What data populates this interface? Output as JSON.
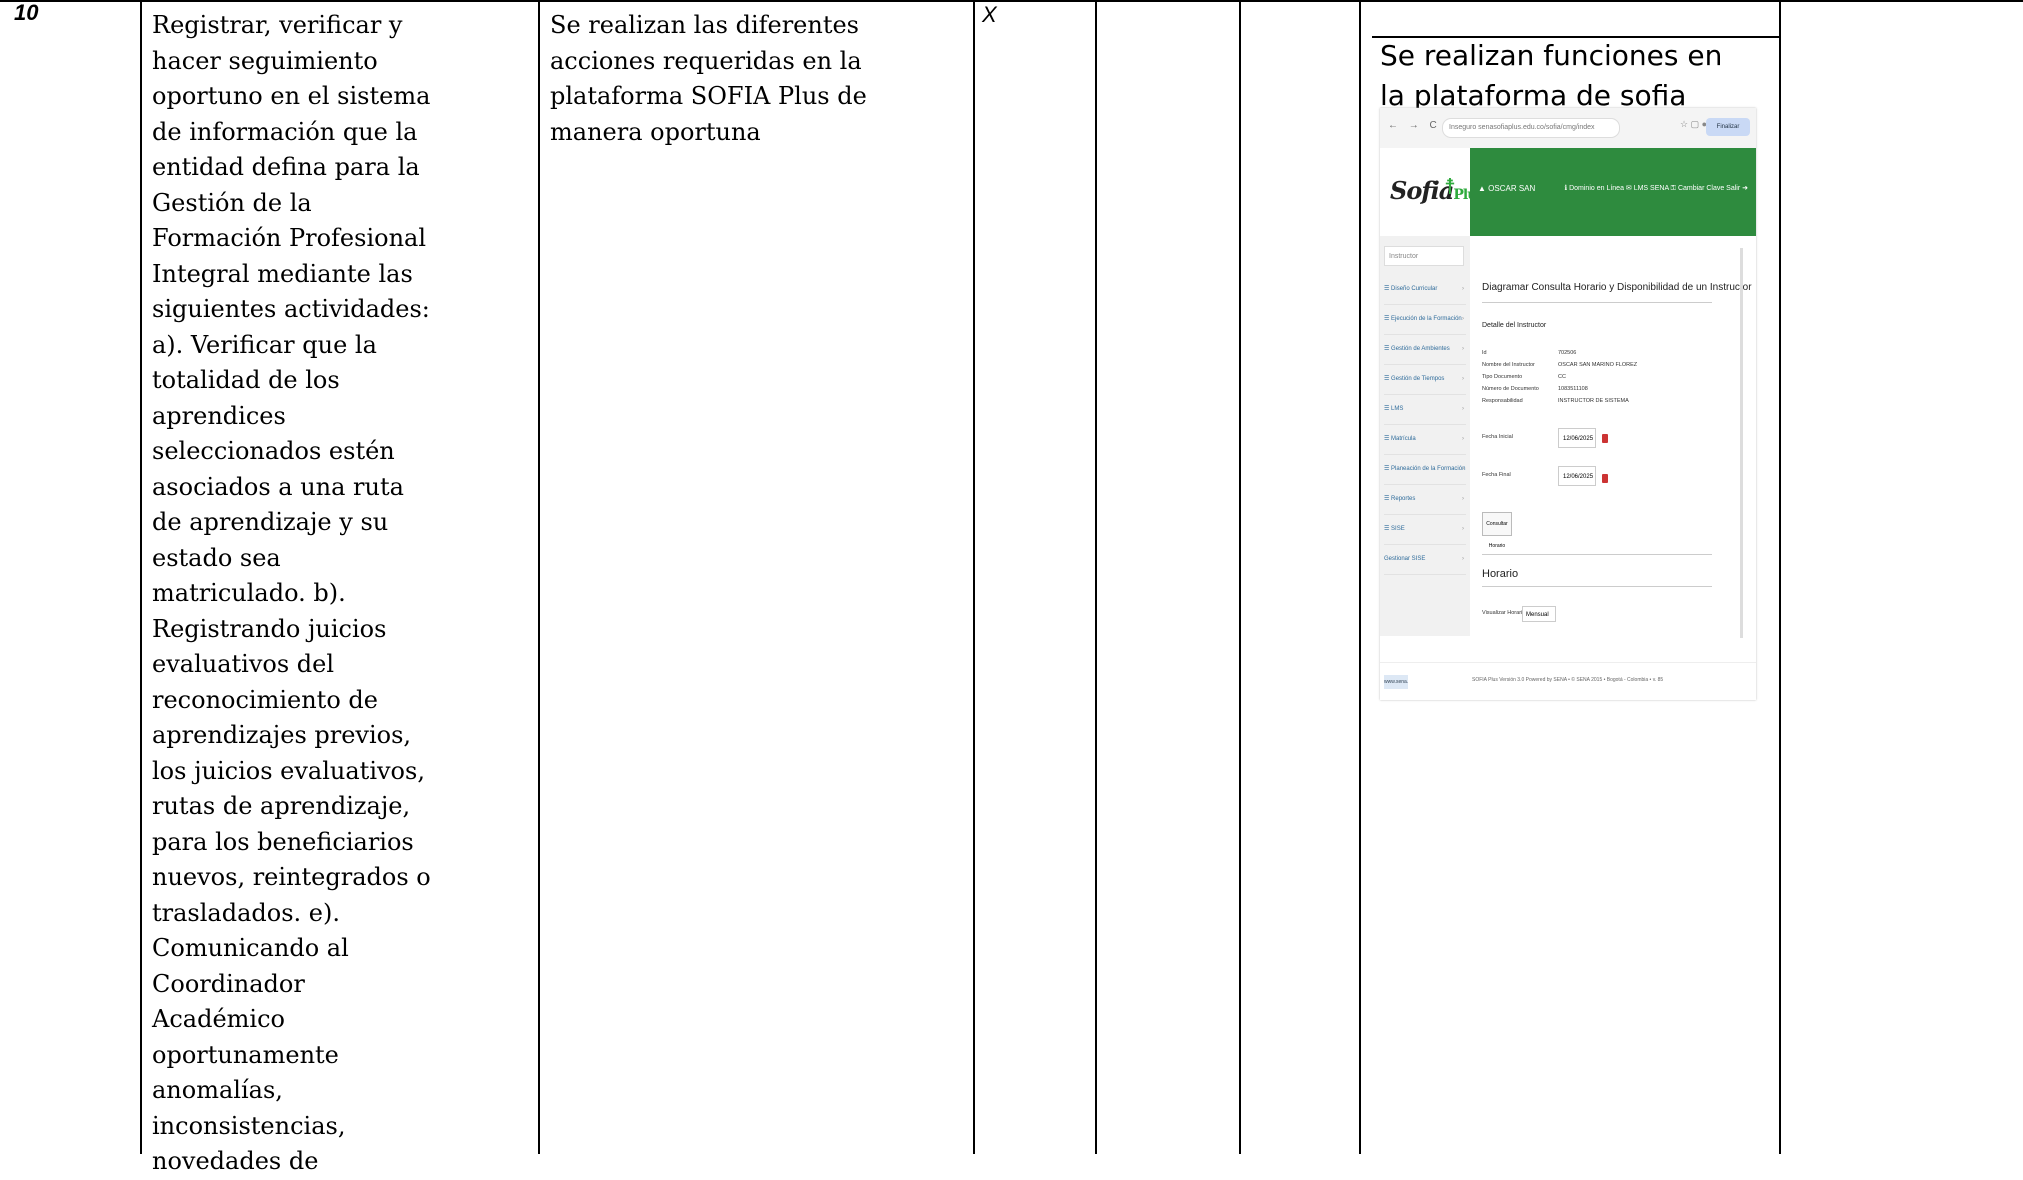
{
  "row": {
    "number": "10",
    "activity_lines": [
      "Registrar, verificar y",
      "hacer seguimiento",
      "oportuno en el sistema",
      "de información que la",
      "entidad defina para la",
      "Gestión de la",
      "Formación Profesional",
      "Integral mediante las",
      "siguientes actividades:",
      "a). Verificar que la",
      "totalidad de los",
      "aprendices",
      "seleccionados estén",
      "asociados a una ruta",
      "de aprendizaje y su",
      "estado sea",
      "matriculado. b).",
      "Registrando juicios",
      "evaluativos del",
      "reconocimiento de",
      "aprendizajes previos,",
      "los juicios evaluativos,",
      "rutas de aprendizaje,",
      "para los beneficiarios",
      "nuevos, reintegrados o",
      "trasladados. e).",
      "Comunicando al",
      "Coordinador",
      "Académico",
      "oportunamente",
      "anomalías,",
      "inconsistencias,",
      "novedades de"
    ],
    "execution_lines": [
      "Se realizan las diferentes",
      "acciones requeridas en la",
      "plataforma SOFIA Plus de",
      "manera oportuna"
    ],
    "mark": "X",
    "evidence_caption": "Se realizan funciones en la plataforma de sofia plus",
    "screenshot": {
      "nav": "←  →  C",
      "url": "Inseguro  senasofiaplus.edu.co/sofia/cmg/index",
      "update_button": "Finalizar actualización",
      "logo_main": "Sofia",
      "logo_sub": "Plus",
      "header_left": "▲ OSCAR SAN",
      "header_right": "ℹ  Dominio en Línea   ✉ LMS SENA   ⚿ Cambiar Clave   Salir ➜",
      "sidebar_search": "Instructor",
      "sidebar_items": [
        "☰ Diseño Curricular",
        "☰ Ejecución de la Formación",
        "☰ Gestión de Ambientes",
        "☰ Gestión de Tiempos",
        "☰ LMS",
        "☰ Matrícula",
        "☰ Planeación de la Formación",
        "☰ Reportes",
        "☰ SISE",
        "Gestionar SISE"
      ],
      "title": "Diagramar Consulta Horario y Disponibilidad de un Instructor",
      "subtitle": "Detalle del Instructor",
      "fields": [
        {
          "label": "Id",
          "value": "702506"
        },
        {
          "label": "Nombre del Instructor",
          "value": "OSCAR SAN MARINO FLOREZ"
        },
        {
          "label": "Tipo Documento",
          "value": "CC"
        },
        {
          "label": "Número de Documento",
          "value": "1083511108"
        },
        {
          "label": "Responsabilidad",
          "value": "INSTRUCTOR DE SISTEMA"
        }
      ],
      "fecha_inicial_label": "Fecha Inicial",
      "fecha_inicial": "12/06/2025",
      "fecha_final_label": "Fecha Final",
      "fecha_final": "12/06/2025",
      "consult_button": "Consultar Horario",
      "horario_heading": "Horario",
      "visualizar_label": "Visualizar Horario",
      "visualizar_value": "Mensual",
      "footer_link": "www.sena.edu.co",
      "footer_text": "SOFIA Plus Versión 3.0 Powered by SENA • © SENA 2015 • Bogotá - Colombia • v. 85"
    }
  }
}
